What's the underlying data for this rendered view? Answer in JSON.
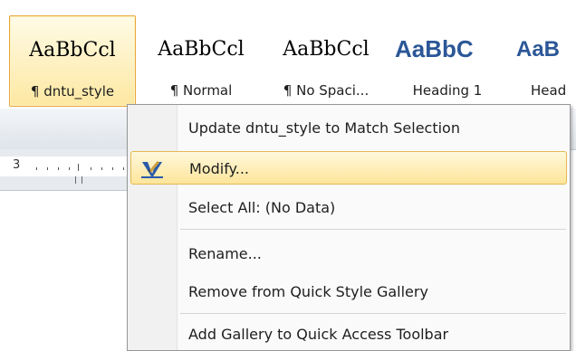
{
  "gallery": {
    "tiles": [
      {
        "sample": "AaBbCcl",
        "name": "¶ dntu_style"
      },
      {
        "sample": "AaBbCcl",
        "name": "¶ Normal"
      },
      {
        "sample": "AaBbCcl",
        "name": "¶ No Spaci..."
      },
      {
        "sample": "AaBbC",
        "name": "Heading 1"
      },
      {
        "sample": "AaB",
        "name": "Head"
      }
    ],
    "heading_color": "#2b5797",
    "selected_border_color": "#e7a63c"
  },
  "ruler": {
    "number": "3"
  },
  "context_menu": {
    "items": [
      {
        "label": "Update dntu_style to Match Selection",
        "icon": ""
      },
      {
        "label": "Modify...",
        "icon": "modify-style-icon"
      },
      {
        "label": "Select All: (No Data)",
        "icon": ""
      },
      {
        "label": "Rename...",
        "icon": ""
      },
      {
        "label": "Remove from Quick Style Gallery",
        "icon": ""
      },
      {
        "label": "Add Gallery to Quick Access Toolbar",
        "icon": ""
      }
    ],
    "highlight_color": "#fde59a"
  }
}
